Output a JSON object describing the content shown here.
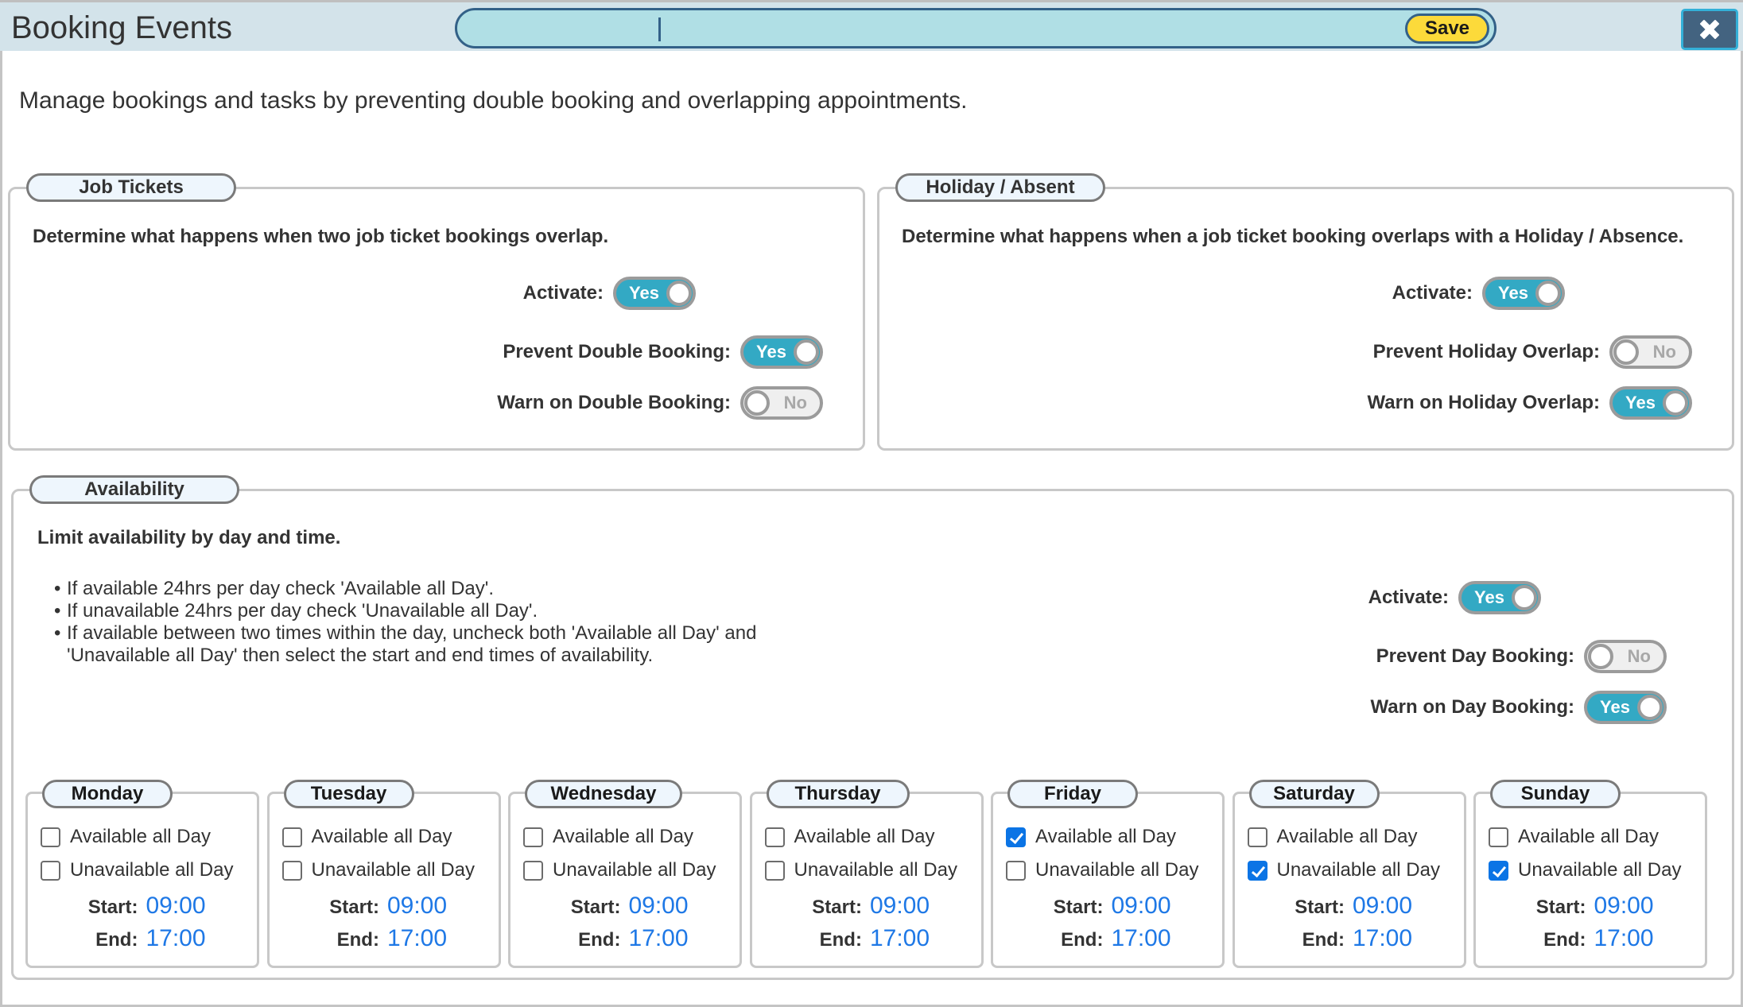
{
  "header": {
    "title": "Booking Events",
    "search_value": "",
    "search_value_2": "",
    "save_label": "Save",
    "close_icon": "close-x-icon"
  },
  "subtitle": "Manage bookings and tasks by preventing double booking and overlapping appointments.",
  "job_tickets": {
    "legend": "Job Tickets",
    "description": "Determine what happens when two job ticket bookings overlap.",
    "toggles": [
      {
        "label": "Activate:",
        "state": "Yes",
        "on": true
      },
      {
        "label": "Prevent Double Booking:",
        "state": "Yes",
        "on": true
      },
      {
        "label": "Warn on Double Booking:",
        "state": "No",
        "on": false
      }
    ]
  },
  "holiday": {
    "legend": "Holiday / Absent",
    "description": "Determine what happens when a job ticket booking overlaps with a Holiday / Absence.",
    "toggles": [
      {
        "label": "Activate:",
        "state": "Yes",
        "on": true
      },
      {
        "label": "Prevent Holiday Overlap:",
        "state": "No",
        "on": false
      },
      {
        "label": "Warn on Holiday Overlap:",
        "state": "Yes",
        "on": true
      }
    ]
  },
  "availability": {
    "legend": "Availability",
    "description": "Limit availability by day and time.",
    "bullets": [
      "If available 24hrs per day check 'Available all Day'.",
      "If unavailable 24hrs per day check 'Unavailable all Day'.",
      "If available between two times within the day, uncheck both 'Available all Day' and",
      "'Unavailable all Day' then select the start and end times of availability."
    ],
    "toggles": [
      {
        "label": "Activate:",
        "state": "Yes",
        "on": true
      },
      {
        "label": "Prevent Day Booking:",
        "state": "No",
        "on": false
      },
      {
        "label": "Warn on Day Booking:",
        "state": "Yes",
        "on": true
      }
    ],
    "labels": {
      "available": "Available all Day",
      "unavailable": "Unavailable all Day",
      "start": "Start:",
      "end": "End:"
    },
    "days": [
      {
        "name": "Monday",
        "available_all_day": false,
        "unavailable_all_day": false,
        "start": "09:00",
        "end": "17:00"
      },
      {
        "name": "Tuesday",
        "available_all_day": false,
        "unavailable_all_day": false,
        "start": "09:00",
        "end": "17:00"
      },
      {
        "name": "Wednesday",
        "available_all_day": false,
        "unavailable_all_day": false,
        "start": "09:00",
        "end": "17:00"
      },
      {
        "name": "Thursday",
        "available_all_day": false,
        "unavailable_all_day": false,
        "start": "09:00",
        "end": "17:00"
      },
      {
        "name": "Friday",
        "available_all_day": true,
        "unavailable_all_day": false,
        "start": "09:00",
        "end": "17:00"
      },
      {
        "name": "Saturday",
        "available_all_day": false,
        "unavailable_all_day": true,
        "start": "09:00",
        "end": "17:00"
      },
      {
        "name": "Sunday",
        "available_all_day": false,
        "unavailable_all_day": true,
        "start": "09:00",
        "end": "17:00"
      }
    ]
  },
  "colors": {
    "header_bg": "#d3e3ea",
    "search_bg": "#b0dfe5",
    "accent_border": "#336188",
    "save_bg": "#fcda3a",
    "close_bg": "#436380",
    "toggle_on": "#33a9c4",
    "toggle_off": "#efefef",
    "checkbox_checked": "#0b74e5",
    "time_value": "#1e78e6"
  }
}
